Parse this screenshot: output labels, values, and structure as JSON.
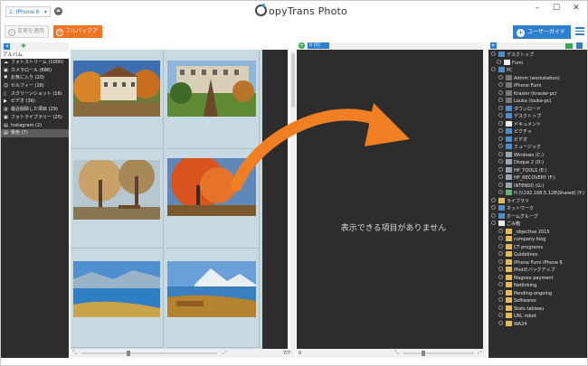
{
  "titlebar": {
    "device": "1: iPhone 6",
    "app_title": "CopyTrans Photo",
    "app_title_rest": "opyTrans Photo",
    "minimize": "–",
    "maximize": "☐",
    "close": "✕"
  },
  "toolbar": {
    "apply_label": "変更を適用",
    "backup_label": "フルバックアップ",
    "guide_label": "ユーザーガイド"
  },
  "albums": {
    "header": "アルバム",
    "items": [
      {
        "label": "フォトストリーム (1000)",
        "icon": "cloud-icon",
        "glyph": "☁"
      },
      {
        "label": "カメラロール (686)",
        "icon": "camera-icon",
        "glyph": "▣"
      },
      {
        "label": "お気に入り (20)",
        "icon": "heart-icon",
        "glyph": "♥"
      },
      {
        "label": "セルフィー (16)",
        "icon": "person-icon",
        "glyph": "☺"
      },
      {
        "label": "スクリーンショット (16)",
        "icon": "phone-icon",
        "glyph": "▯"
      },
      {
        "label": "ビデオ (36)",
        "icon": "video-icon",
        "glyph": "▶"
      },
      {
        "label": "最近削除した項目 (29)",
        "icon": "trash-icon",
        "glyph": "▥"
      },
      {
        "label": "フォトライブラリー (25)",
        "icon": "camera-icon",
        "glyph": "▣"
      },
      {
        "label": "Instagram (2)",
        "icon": "album-icon",
        "glyph": "▤"
      },
      {
        "label": "景色 (7)",
        "icon": "album-icon",
        "glyph": "▤"
      }
    ]
  },
  "grid": {
    "count": "7/7"
  },
  "middle": {
    "tag": "0 (0)",
    "empty_message": "表示できる項目がありません",
    "count": "0"
  },
  "tree": {
    "items": [
      {
        "label": "デスクトップ",
        "icon": "desktop-icon",
        "cls": "blue"
      },
      {
        "label": "Fumi",
        "icon": "user-folder-icon",
        "cls": "white"
      },
      {
        "label": "PC",
        "icon": "pc-icon",
        "cls": "blue"
      },
      {
        "label": "Admin (workstation)",
        "icon": "computer-icon",
        "cls": "dark"
      },
      {
        "label": "iPhone Fumi",
        "icon": "iphone-icon",
        "cls": "dark"
      },
      {
        "label": "Krasier (krasier-pc)",
        "icon": "computer-icon",
        "cls": "dark"
      },
      {
        "label": "Louka (louka-pc)",
        "icon": "computer-icon",
        "cls": "dark"
      },
      {
        "label": "ダウンロード",
        "icon": "download-folder-icon",
        "cls": "blue"
      },
      {
        "label": "デスクトップ",
        "icon": "desktop-icon",
        "cls": "blue"
      },
      {
        "label": "ドキュメント",
        "icon": "documents-icon",
        "cls": "white"
      },
      {
        "label": "ピクチャ",
        "icon": "pictures-icon",
        "cls": "blue"
      },
      {
        "label": "ビデオ",
        "icon": "videos-icon",
        "cls": "blue"
      },
      {
        "label": "ミュージック",
        "icon": "music-icon",
        "cls": "blue"
      },
      {
        "label": "Windows (C:)",
        "icon": "drive-icon",
        "cls": "drive"
      },
      {
        "label": "Disque 2 (D:)",
        "icon": "drive-icon",
        "cls": "drive"
      },
      {
        "label": "HP_TOOLS (E:)",
        "icon": "drive-icon",
        "cls": "drive"
      },
      {
        "label": "HP_RECOVERY (F:)",
        "icon": "drive-icon",
        "cls": "drive"
      },
      {
        "label": "INTENSO (G:)",
        "icon": "usb-drive-icon",
        "cls": "drive"
      },
      {
        "label": "H (\\\\192.168.5.128\\Shared) (Y:)",
        "icon": "network-drive-icon",
        "cls": "green"
      },
      {
        "label": "ライブラリ",
        "icon": "library-icon",
        "cls": "folder"
      },
      {
        "label": "ネットワーク",
        "icon": "network-icon",
        "cls": "blue"
      },
      {
        "label": "ホームグループ",
        "icon": "homegroup-icon",
        "cls": "blue"
      },
      {
        "label": "ごみ箱",
        "icon": "recycle-bin-icon",
        "cls": "white"
      },
      {
        "label": "_objective 2015",
        "icon": "folder-icon",
        "cls": "folder"
      },
      {
        "label": "company blog",
        "icon": "folder-icon",
        "cls": "folder"
      },
      {
        "label": "CT programs",
        "icon": "folder-icon",
        "cls": "folder"
      },
      {
        "label": "Guidelines",
        "icon": "folder-icon",
        "cls": "folder"
      },
      {
        "label": "iPhone Fumi iPhone 6",
        "icon": "folder-icon",
        "cls": "folder"
      },
      {
        "label": "iPodのバックアップ",
        "icon": "folder-icon",
        "cls": "folder"
      },
      {
        "label": "Magnex payment",
        "icon": "folder-icon",
        "cls": "folder"
      },
      {
        "label": "Netlinking",
        "icon": "folder-icon",
        "cls": "folder"
      },
      {
        "label": "Pending-ongoing",
        "icon": "folder-icon",
        "cls": "folder"
      },
      {
        "label": "Softwares",
        "icon": "folder-icon",
        "cls": "folder"
      },
      {
        "label": "Stats tableau",
        "icon": "folder-icon",
        "cls": "folder"
      },
      {
        "label": "URL robot",
        "icon": "folder-icon",
        "cls": "folder"
      },
      {
        "label": "WA24",
        "icon": "folder-icon",
        "cls": "folder"
      }
    ]
  },
  "colors": {
    "accent_blue": "#2f7fd1",
    "backup_orange": "#f07424",
    "arrow_orange": "#f07e22",
    "panel_dark": "#2d2d2d"
  }
}
